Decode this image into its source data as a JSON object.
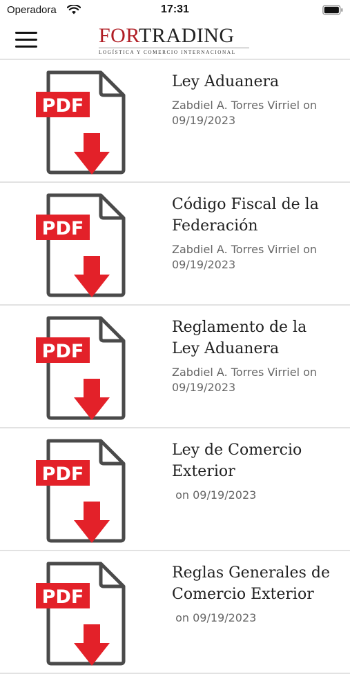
{
  "status_bar": {
    "carrier": "Operadora",
    "time": "17:31"
  },
  "header": {
    "logo_prefix": "FOR",
    "logo_suffix": "TRADING",
    "logo_tagline": "LOGÍSTICA Y COMERCIO INTERNACIONAL",
    "menu_icon": "hamburger-icon"
  },
  "documents": [
    {
      "title": "Ley Aduanera",
      "meta": "Zabdiel A. Torres Virriel on 09/19/2023",
      "icon": "pdf-download-icon",
      "icon_label": "PDF"
    },
    {
      "title": "Código Fiscal de la Federación",
      "meta": "Zabdiel A. Torres Virriel on 09/19/2023",
      "icon": "pdf-download-icon",
      "icon_label": "PDF"
    },
    {
      "title": "Reglamento de la Ley Aduanera",
      "meta": "Zabdiel A. Torres Virriel on 09/19/2023",
      "icon": "pdf-download-icon",
      "icon_label": "PDF"
    },
    {
      "title": "Ley de Comercio Exterior",
      "meta": " on 09/19/2023",
      "icon": "pdf-download-icon",
      "icon_label": "PDF"
    },
    {
      "title": "Reglas Generales de Comercio Exterior",
      "meta": " on 09/19/2023",
      "icon": "pdf-download-icon",
      "icon_label": "PDF"
    }
  ],
  "colors": {
    "accent_red": "#e32129",
    "brand_red": "#b01d24",
    "icon_outline": "#4a4a4a"
  }
}
